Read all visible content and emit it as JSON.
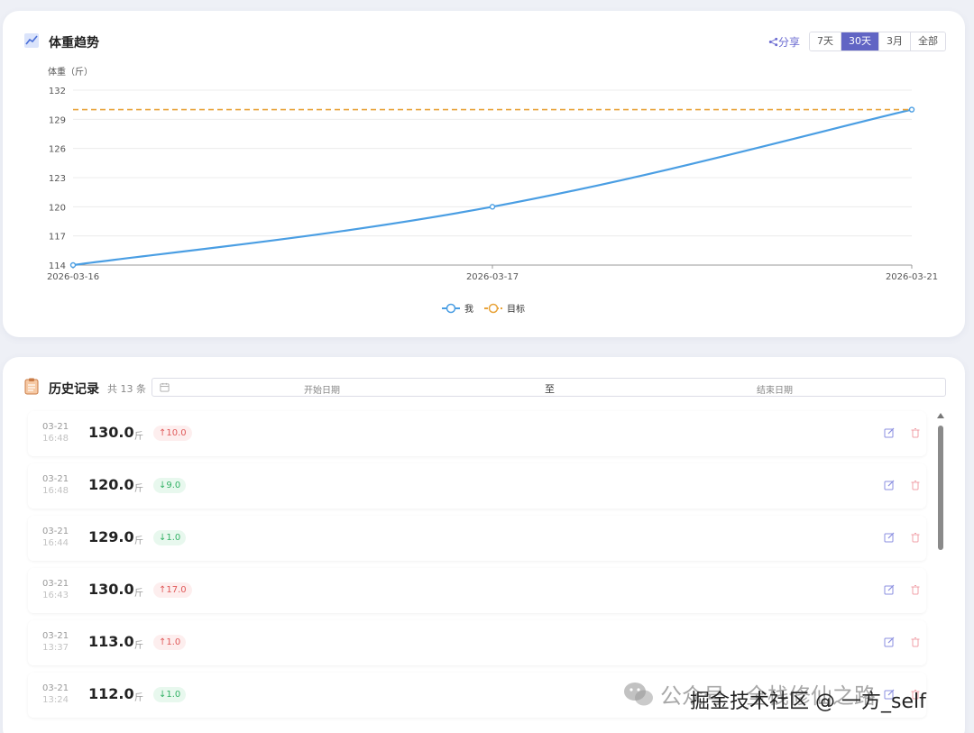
{
  "trend": {
    "title": "体重趋势",
    "share_label": "分享",
    "ranges": [
      "7天",
      "30天",
      "3月",
      "全部"
    ],
    "active_range": "30天",
    "legend": {
      "me": "我",
      "goal": "目标"
    }
  },
  "chart_data": {
    "type": "line",
    "ylabel": "体重（斤）",
    "ylim": [
      114,
      132
    ],
    "yticks": [
      114,
      117,
      120,
      123,
      126,
      129,
      132
    ],
    "x": [
      "2026-03-16",
      "2026-03-17",
      "2026-03-21"
    ],
    "series": [
      {
        "name": "我",
        "values": [
          114,
          120,
          130
        ],
        "color": "#4a9ee3"
      },
      {
        "name": "目标",
        "values": [
          130,
          130,
          130
        ],
        "color": "#e8a33a",
        "dashed": true
      }
    ],
    "grid": true,
    "legend": "bottom-center"
  },
  "history": {
    "title": "历史记录",
    "count_text": "共 13 条",
    "date_start_placeholder": "开始日期",
    "date_to": "至",
    "date_end_placeholder": "结束日期",
    "unit": "斤",
    "records": [
      {
        "date": "03-21",
        "time": "16:48",
        "weight": "130.0",
        "delta": "10.0",
        "dir": "up"
      },
      {
        "date": "03-21",
        "time": "16:48",
        "weight": "120.0",
        "delta": "9.0",
        "dir": "down"
      },
      {
        "date": "03-21",
        "time": "16:44",
        "weight": "129.0",
        "delta": "1.0",
        "dir": "down"
      },
      {
        "date": "03-21",
        "time": "16:43",
        "weight": "130.0",
        "delta": "17.0",
        "dir": "up"
      },
      {
        "date": "03-21",
        "time": "13:37",
        "weight": "113.0",
        "delta": "1.0",
        "dir": "up"
      },
      {
        "date": "03-21",
        "time": "13:24",
        "weight": "112.0",
        "delta": "1.0",
        "dir": "down"
      }
    ]
  },
  "watermark": {
    "line1": "公众号 · 全栈修仙之路",
    "line2": "掘金技术社区 @ 一方_self"
  },
  "colors": {
    "accent": "#6165c4",
    "line": "#4a9ee3",
    "goal": "#e8a33a",
    "up": "#e05a5a",
    "down": "#35b267"
  }
}
